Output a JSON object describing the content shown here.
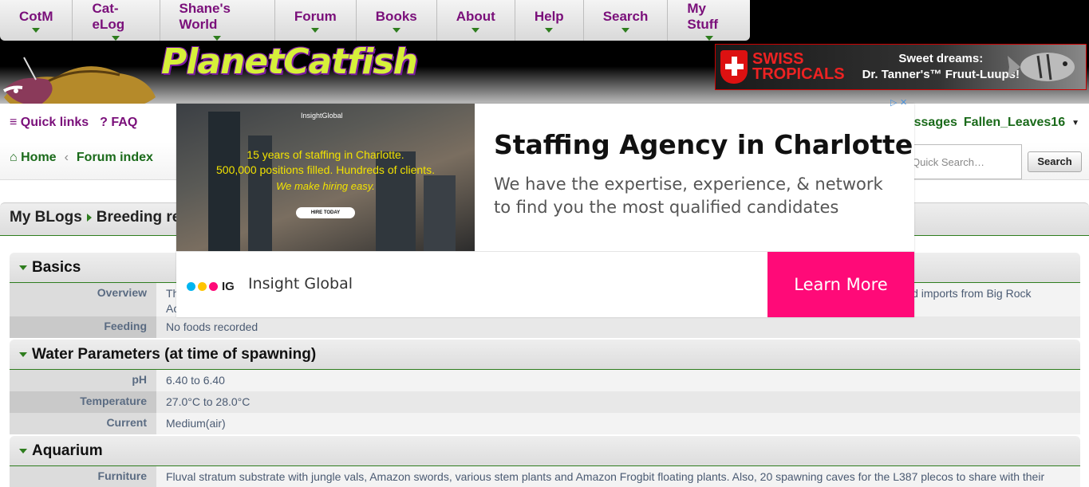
{
  "nav": {
    "items": [
      {
        "label": "CotM"
      },
      {
        "label": "Cat-eLog"
      },
      {
        "label": "Shane's World"
      },
      {
        "label": "Forum"
      },
      {
        "label": "Books"
      },
      {
        "label": "About"
      },
      {
        "label": "Help"
      },
      {
        "label": "Search"
      },
      {
        "label": "My Stuff"
      }
    ]
  },
  "header": {
    "site_name": "PlanetCatfish",
    "banner": {
      "brand_line1": "SWISS",
      "brand_line2": "TROPICALS",
      "slogan_line1": "Sweet dreams:",
      "slogan_line2": "Dr. Tanner's™ Fruut-Luups!"
    }
  },
  "toolbar": {
    "quick_links": "Quick links",
    "faq": "FAQ",
    "messages": "messages",
    "username": "Fallen_Leaves16"
  },
  "breadcrumb": {
    "home": "Home",
    "forum_index": "Forum index"
  },
  "search": {
    "placeholder": "Quick Search…",
    "button": "Search"
  },
  "page_title": {
    "part1": "My BLogs",
    "part2": "Breeding re"
  },
  "sections": {
    "basics": {
      "title": "Basics",
      "overview_label": "Overview",
      "overview_value_start": "Th",
      "overview_value_end": "ld imports from Big Rock",
      "overview_value_line2": "Ac",
      "feeding_label": "Feeding",
      "feeding_value": "No foods recorded"
    },
    "water": {
      "title": "Water Parameters (at time of spawning)",
      "ph_label": "pH",
      "ph_value": "6.40 to 6.40",
      "temp_label": "Temperature",
      "temp_value": "27.0°C to 28.0°C",
      "current_label": "Current",
      "current_value": "Medium(air)"
    },
    "aquarium": {
      "title": "Aquarium",
      "furniture_label": "Furniture",
      "furniture_value": "Fluval stratum substrate with jungle vals, Amazon swords, various stem plants and Amazon Frogbit floating plants. Also, 20 spawning caves for the L387 plecos to share with their L264 roomates."
    }
  },
  "ad": {
    "image_brand": "InsightGlobal",
    "image_line1": "15 years of staffing in Charlotte.",
    "image_line2": "500,000 positions filled. Hundreds of clients.",
    "image_line3": "We make hiring easy.",
    "image_button": "HIRE TODAY",
    "headline": "Staffing Agency in Charlotte",
    "body": "We have the expertise, experience, & network to find you the most qualified candidates",
    "logo_text": "IG",
    "advertiser": "Insight Global",
    "cta": "Learn More",
    "colors": {
      "cta": "#ff0a78",
      "dot1": "#00b5f0",
      "dot2": "#ffc400",
      "dot3": "#ff0a78"
    }
  }
}
